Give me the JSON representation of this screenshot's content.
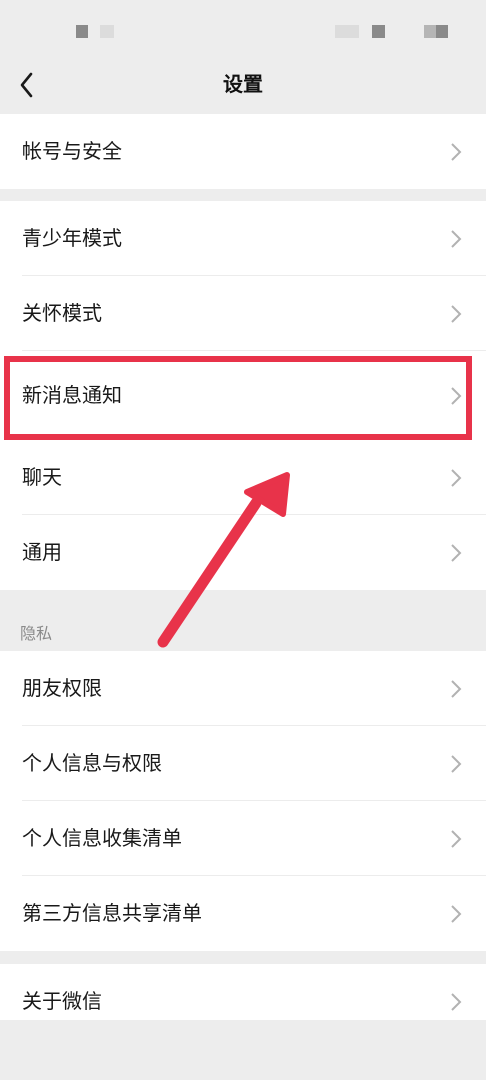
{
  "nav": {
    "title": "设置"
  },
  "groups": [
    {
      "items": [
        {
          "label": "帐号与安全"
        }
      ]
    },
    {
      "items": [
        {
          "label": "青少年模式"
        },
        {
          "label": "关怀模式"
        },
        {
          "label": "新消息通知"
        },
        {
          "label": "聊天"
        },
        {
          "label": "通用"
        }
      ]
    },
    {
      "header": "隐私",
      "items": [
        {
          "label": "朋友权限"
        },
        {
          "label": "个人信息与权限"
        },
        {
          "label": "个人信息收集清单"
        },
        {
          "label": "第三方信息共享清单"
        }
      ]
    },
    {
      "items": [
        {
          "label": "关于微信"
        }
      ]
    }
  ],
  "icons": {
    "back": "chevron-left-icon",
    "row": "chevron-right-icon"
  },
  "colors": {
    "background": "#ededed",
    "card": "#ffffff",
    "highlight": "#e8334a",
    "chevron": "#b2b2b2"
  }
}
